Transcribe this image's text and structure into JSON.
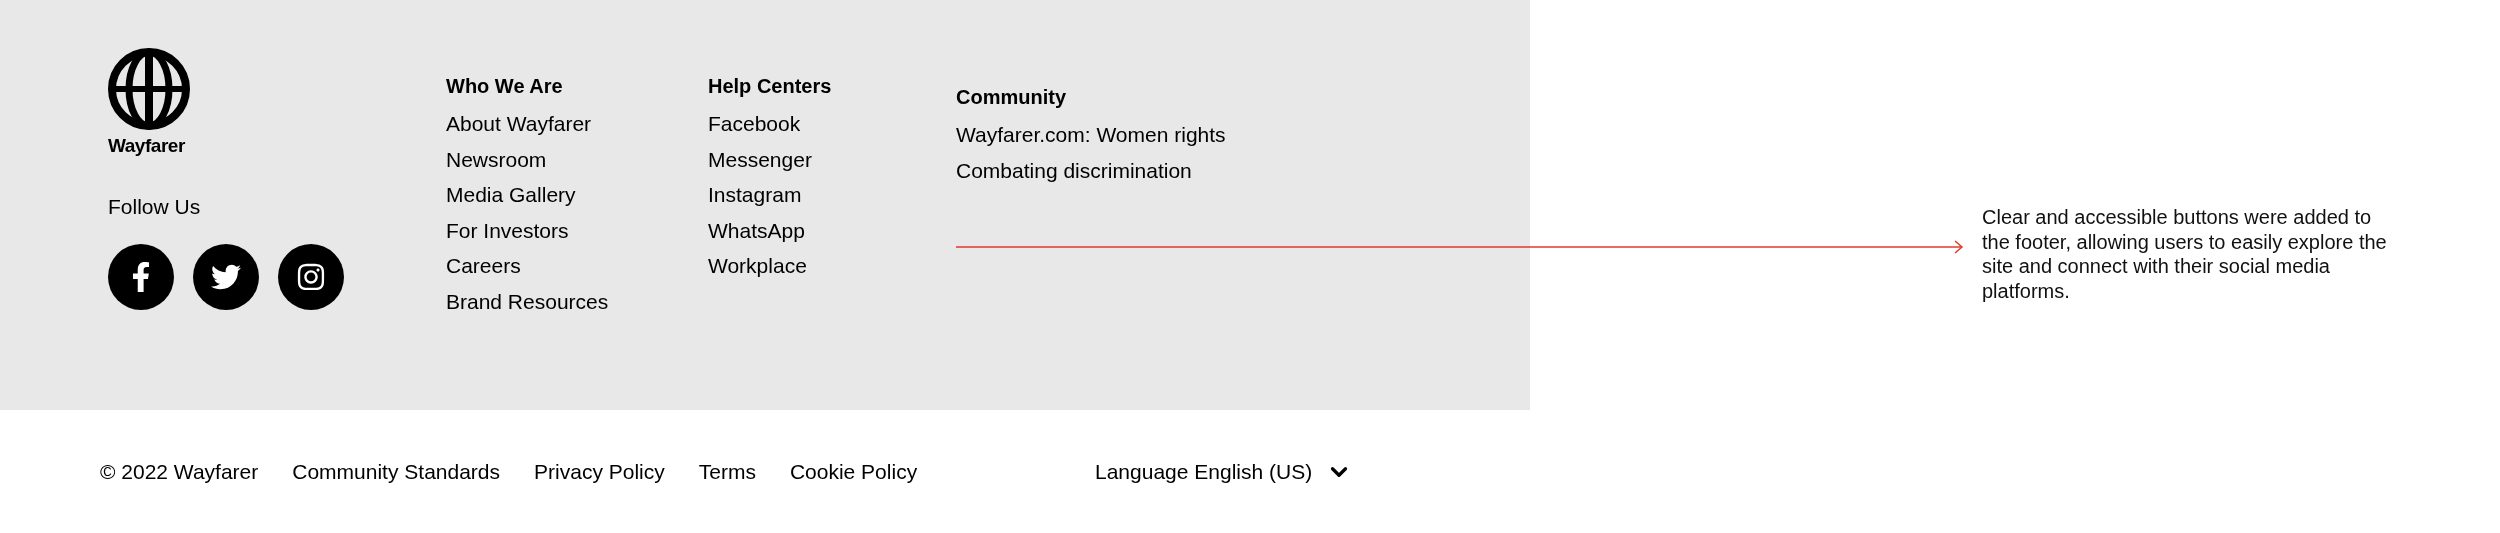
{
  "footer": {
    "logo": {
      "name": "Wayfarer"
    },
    "follow_us": {
      "label": "Follow Us",
      "socials": [
        {
          "kind": "facebook"
        },
        {
          "kind": "twitter"
        },
        {
          "kind": "instagram"
        }
      ]
    },
    "columns": [
      {
        "heading": "Who We Are",
        "links": [
          "About Wayfarer",
          "Newsroom",
          "Media Gallery",
          "For Investors",
          "Careers",
          "Brand Resources"
        ]
      },
      {
        "heading": "Help Centers",
        "links": [
          "Facebook",
          "Messenger",
          "Instagram",
          "WhatsApp",
          "Workplace"
        ]
      },
      {
        "heading": "Community",
        "links": [
          "Wayfarer.com: Women rights",
          "Combating discrimination"
        ]
      }
    ]
  },
  "bottom_bar": {
    "copyright": "© 2022 Wayfarer",
    "links": [
      "Community Standards",
      "Privacy Policy",
      "Terms",
      "Cookie Policy"
    ],
    "language": "Language English (US)"
  },
  "annotation": {
    "text": "Clear and accessible buttons were added to the footer, allowing users to easily explore the site and connect with their social media platforms."
  }
}
